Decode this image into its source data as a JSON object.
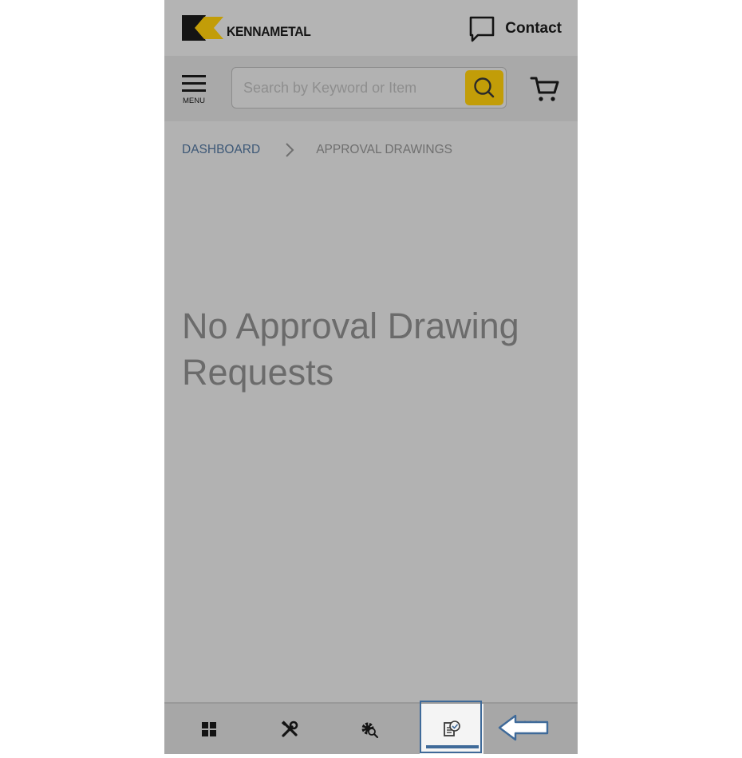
{
  "header": {
    "brand": "KENNAMETAL",
    "contact_label": "Contact",
    "logo_icon": "kennametal-k-logo",
    "contact_icon": "chat-bubble-icon"
  },
  "search": {
    "menu_label": "MENU",
    "placeholder": "Search by Keyword or Item",
    "value": "",
    "search_icon": "magnifier-icon",
    "cart_icon": "shopping-cart-icon"
  },
  "breadcrumb": {
    "items": [
      {
        "label": "DASHBOARD",
        "link": true
      },
      {
        "label": "APPROVAL DRAWINGS",
        "link": false
      }
    ],
    "separator_icon": "chevron-right-icon"
  },
  "main": {
    "empty_message": "No Approval Drawing Requests"
  },
  "bottom_nav": {
    "items": [
      {
        "icon": "dashboard-grid-icon",
        "active": false
      },
      {
        "icon": "tools-icon",
        "active": false
      },
      {
        "icon": "gear-search-icon",
        "active": false
      },
      {
        "icon": "approval-drawing-icon",
        "active": true
      },
      {
        "icon": "more-icon",
        "active": false
      }
    ]
  },
  "annotation": {
    "icon": "left-arrow-pointer",
    "target": "approval-drawing tab"
  },
  "colors": {
    "brand_yellow": "#c29d08",
    "accent_blue": "#3f6a99",
    "overlay_gray": "#b2b2b2"
  }
}
